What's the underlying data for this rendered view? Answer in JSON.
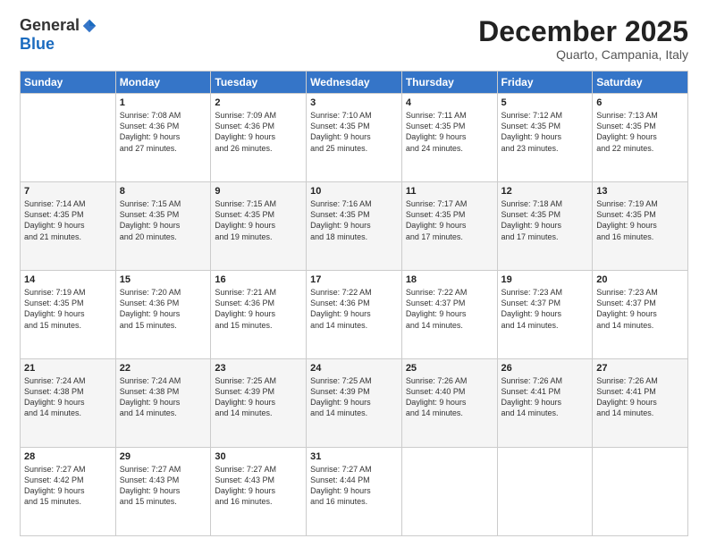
{
  "header": {
    "logo_general": "General",
    "logo_blue": "Blue",
    "month_title": "December 2025",
    "subtitle": "Quarto, Campania, Italy"
  },
  "days_of_week": [
    "Sunday",
    "Monday",
    "Tuesday",
    "Wednesday",
    "Thursday",
    "Friday",
    "Saturday"
  ],
  "weeks": [
    [
      {
        "day": "",
        "lines": []
      },
      {
        "day": "1",
        "lines": [
          "Sunrise: 7:08 AM",
          "Sunset: 4:36 PM",
          "Daylight: 9 hours",
          "and 27 minutes."
        ]
      },
      {
        "day": "2",
        "lines": [
          "Sunrise: 7:09 AM",
          "Sunset: 4:36 PM",
          "Daylight: 9 hours",
          "and 26 minutes."
        ]
      },
      {
        "day": "3",
        "lines": [
          "Sunrise: 7:10 AM",
          "Sunset: 4:35 PM",
          "Daylight: 9 hours",
          "and 25 minutes."
        ]
      },
      {
        "day": "4",
        "lines": [
          "Sunrise: 7:11 AM",
          "Sunset: 4:35 PM",
          "Daylight: 9 hours",
          "and 24 minutes."
        ]
      },
      {
        "day": "5",
        "lines": [
          "Sunrise: 7:12 AM",
          "Sunset: 4:35 PM",
          "Daylight: 9 hours",
          "and 23 minutes."
        ]
      },
      {
        "day": "6",
        "lines": [
          "Sunrise: 7:13 AM",
          "Sunset: 4:35 PM",
          "Daylight: 9 hours",
          "and 22 minutes."
        ]
      }
    ],
    [
      {
        "day": "7",
        "lines": [
          "Sunrise: 7:14 AM",
          "Sunset: 4:35 PM",
          "Daylight: 9 hours",
          "and 21 minutes."
        ]
      },
      {
        "day": "8",
        "lines": [
          "Sunrise: 7:15 AM",
          "Sunset: 4:35 PM",
          "Daylight: 9 hours",
          "and 20 minutes."
        ]
      },
      {
        "day": "9",
        "lines": [
          "Sunrise: 7:15 AM",
          "Sunset: 4:35 PM",
          "Daylight: 9 hours",
          "and 19 minutes."
        ]
      },
      {
        "day": "10",
        "lines": [
          "Sunrise: 7:16 AM",
          "Sunset: 4:35 PM",
          "Daylight: 9 hours",
          "and 18 minutes."
        ]
      },
      {
        "day": "11",
        "lines": [
          "Sunrise: 7:17 AM",
          "Sunset: 4:35 PM",
          "Daylight: 9 hours",
          "and 17 minutes."
        ]
      },
      {
        "day": "12",
        "lines": [
          "Sunrise: 7:18 AM",
          "Sunset: 4:35 PM",
          "Daylight: 9 hours",
          "and 17 minutes."
        ]
      },
      {
        "day": "13",
        "lines": [
          "Sunrise: 7:19 AM",
          "Sunset: 4:35 PM",
          "Daylight: 9 hours",
          "and 16 minutes."
        ]
      }
    ],
    [
      {
        "day": "14",
        "lines": [
          "Sunrise: 7:19 AM",
          "Sunset: 4:35 PM",
          "Daylight: 9 hours",
          "and 15 minutes."
        ]
      },
      {
        "day": "15",
        "lines": [
          "Sunrise: 7:20 AM",
          "Sunset: 4:36 PM",
          "Daylight: 9 hours",
          "and 15 minutes."
        ]
      },
      {
        "day": "16",
        "lines": [
          "Sunrise: 7:21 AM",
          "Sunset: 4:36 PM",
          "Daylight: 9 hours",
          "and 15 minutes."
        ]
      },
      {
        "day": "17",
        "lines": [
          "Sunrise: 7:22 AM",
          "Sunset: 4:36 PM",
          "Daylight: 9 hours",
          "and 14 minutes."
        ]
      },
      {
        "day": "18",
        "lines": [
          "Sunrise: 7:22 AM",
          "Sunset: 4:37 PM",
          "Daylight: 9 hours",
          "and 14 minutes."
        ]
      },
      {
        "day": "19",
        "lines": [
          "Sunrise: 7:23 AM",
          "Sunset: 4:37 PM",
          "Daylight: 9 hours",
          "and 14 minutes."
        ]
      },
      {
        "day": "20",
        "lines": [
          "Sunrise: 7:23 AM",
          "Sunset: 4:37 PM",
          "Daylight: 9 hours",
          "and 14 minutes."
        ]
      }
    ],
    [
      {
        "day": "21",
        "lines": [
          "Sunrise: 7:24 AM",
          "Sunset: 4:38 PM",
          "Daylight: 9 hours",
          "and 14 minutes."
        ]
      },
      {
        "day": "22",
        "lines": [
          "Sunrise: 7:24 AM",
          "Sunset: 4:38 PM",
          "Daylight: 9 hours",
          "and 14 minutes."
        ]
      },
      {
        "day": "23",
        "lines": [
          "Sunrise: 7:25 AM",
          "Sunset: 4:39 PM",
          "Daylight: 9 hours",
          "and 14 minutes."
        ]
      },
      {
        "day": "24",
        "lines": [
          "Sunrise: 7:25 AM",
          "Sunset: 4:39 PM",
          "Daylight: 9 hours",
          "and 14 minutes."
        ]
      },
      {
        "day": "25",
        "lines": [
          "Sunrise: 7:26 AM",
          "Sunset: 4:40 PM",
          "Daylight: 9 hours",
          "and 14 minutes."
        ]
      },
      {
        "day": "26",
        "lines": [
          "Sunrise: 7:26 AM",
          "Sunset: 4:41 PM",
          "Daylight: 9 hours",
          "and 14 minutes."
        ]
      },
      {
        "day": "27",
        "lines": [
          "Sunrise: 7:26 AM",
          "Sunset: 4:41 PM",
          "Daylight: 9 hours",
          "and 14 minutes."
        ]
      }
    ],
    [
      {
        "day": "28",
        "lines": [
          "Sunrise: 7:27 AM",
          "Sunset: 4:42 PM",
          "Daylight: 9 hours",
          "and 15 minutes."
        ]
      },
      {
        "day": "29",
        "lines": [
          "Sunrise: 7:27 AM",
          "Sunset: 4:43 PM",
          "Daylight: 9 hours",
          "and 15 minutes."
        ]
      },
      {
        "day": "30",
        "lines": [
          "Sunrise: 7:27 AM",
          "Sunset: 4:43 PM",
          "Daylight: 9 hours",
          "and 16 minutes."
        ]
      },
      {
        "day": "31",
        "lines": [
          "Sunrise: 7:27 AM",
          "Sunset: 4:44 PM",
          "Daylight: 9 hours",
          "and 16 minutes."
        ]
      },
      {
        "day": "",
        "lines": []
      },
      {
        "day": "",
        "lines": []
      },
      {
        "day": "",
        "lines": []
      }
    ]
  ]
}
